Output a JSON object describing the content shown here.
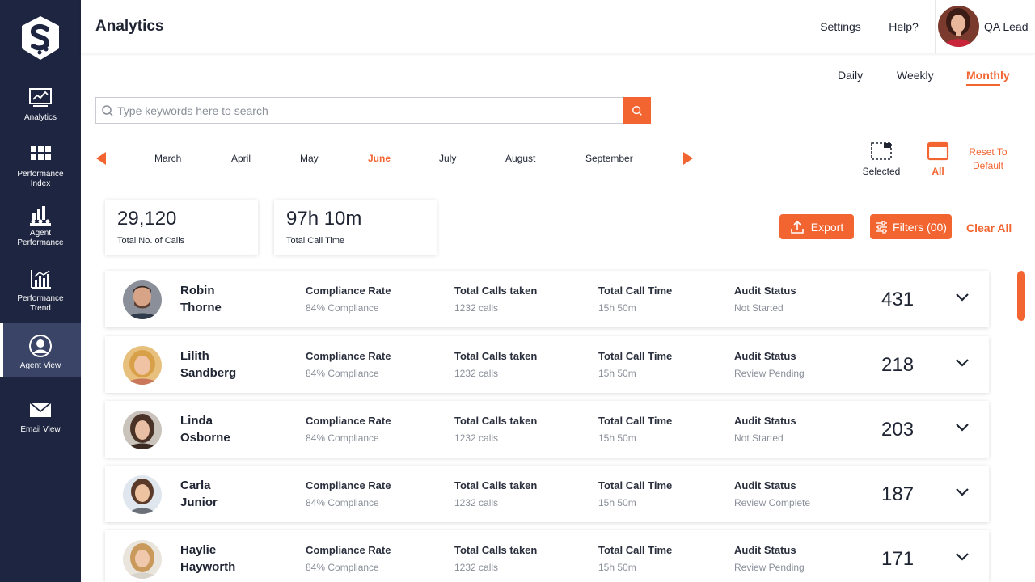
{
  "sidebar": {
    "items": [
      {
        "label": "Analytics",
        "icon": "monitor-chart-icon"
      },
      {
        "label": "Performance\nIndex",
        "icon": "grid-icon"
      },
      {
        "label": "Agent\nPerformance",
        "icon": "agents-chart-icon"
      },
      {
        "label": "Performance\nTrend",
        "icon": "trend-chart-icon"
      },
      {
        "label": "Agent View",
        "icon": "user-circle-icon"
      },
      {
        "label": "Email View",
        "icon": "envelope-icon"
      }
    ],
    "active_index": 4
  },
  "header": {
    "title": "Analytics",
    "settings_label": "Settings",
    "help_label": "Help?",
    "user_name": "QA Lead"
  },
  "period_tabs": [
    "Daily",
    "Weekly",
    "Monthly"
  ],
  "period_active": "Monthly",
  "search": {
    "placeholder": "Type keywords here to search",
    "value": ""
  },
  "months": [
    "March",
    "April",
    "May",
    "June",
    "July",
    "August",
    "September"
  ],
  "month_active": "June",
  "selection": {
    "selected_label": "Selected",
    "all_label": "All",
    "reset_label": "Reset To\nDefault"
  },
  "stats": {
    "total_calls": {
      "value": "29,120",
      "label": "Total No. of Calls"
    },
    "total_time": {
      "value": "97h 10m",
      "label": "Total Call Time"
    }
  },
  "actions": {
    "export_label": "Export",
    "filters_label": "Filters (00)",
    "clear_label": "Clear All"
  },
  "metric_labels": {
    "compliance": "Compliance Rate",
    "calls": "Total Calls taken",
    "time": "Total Call Time",
    "audit": "Audit Status"
  },
  "agents": [
    {
      "first": "Robin",
      "last": "Thorne",
      "compliance": "84% Compliance",
      "calls": "1232 calls",
      "time": "15h 50m",
      "audit": "Not Started",
      "score": "431"
    },
    {
      "first": "Lilith",
      "last": "Sandberg",
      "compliance": "84% Compliance",
      "calls": "1232 calls",
      "time": "15h 50m",
      "audit": "Review Pending",
      "score": "218"
    },
    {
      "first": "Linda",
      "last": "Osborne",
      "compliance": "84% Compliance",
      "calls": "1232 calls",
      "time": "15h 50m",
      "audit": "Not Started",
      "score": "203"
    },
    {
      "first": "Carla",
      "last": "Junior",
      "compliance": "84% Compliance",
      "calls": "1232 calls",
      "time": "15h 50m",
      "audit": "Review Complete",
      "score": "187"
    },
    {
      "first": "Haylie",
      "last": "Hayworth",
      "compliance": "84% Compliance",
      "calls": "1232 calls",
      "time": "15h 50m",
      "audit": "Review Pending",
      "score": "171"
    }
  ],
  "colors": {
    "accent": "#f26430",
    "sidebar": "#1d2540",
    "sidebar_active": "#3a4466"
  }
}
